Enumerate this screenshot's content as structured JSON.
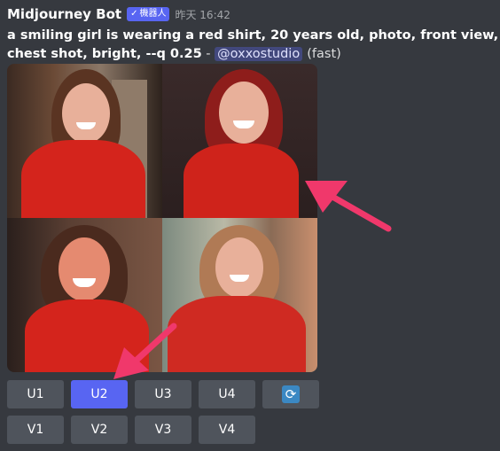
{
  "message": {
    "author": "Midjourney Bot",
    "badge": "機器人",
    "timestamp": "昨天 16:42",
    "prompt": "a smiling girl is wearing a red shirt, 20 years old, photo, front view, chest shot, bright, --q 0.25",
    "separator": " - ",
    "mention": "@oxxostudio",
    "mode": "(fast)"
  },
  "image_grid": {
    "tiles": [
      "image-1",
      "image-2",
      "image-3",
      "image-4"
    ]
  },
  "buttons": {
    "upscale": [
      "U1",
      "U2",
      "U3",
      "U4"
    ],
    "variation": [
      "V1",
      "V2",
      "V3",
      "V4"
    ],
    "reroll_icon": "refresh-icon"
  },
  "colors": {
    "background": "#36393f",
    "button": "#4f545c",
    "primary": "#5865f2",
    "arrow": "#f0386b",
    "shirt": "#d4241c"
  }
}
